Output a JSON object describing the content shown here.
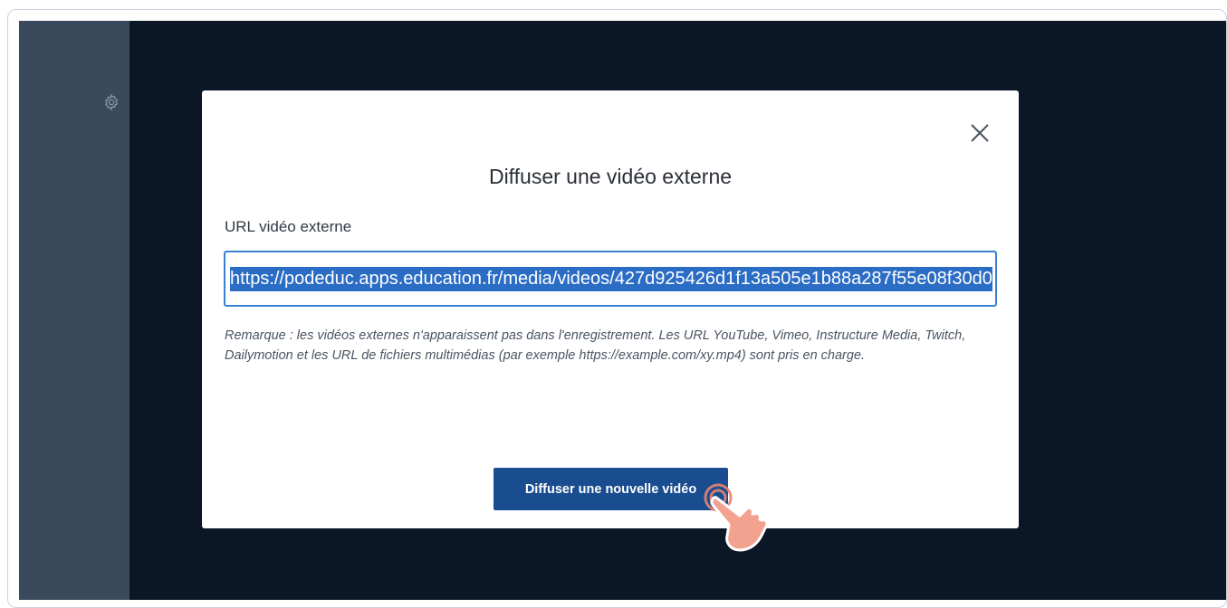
{
  "modal": {
    "title": "Diffuser une vidéo externe",
    "field_label": "URL vidéo externe",
    "url_value": "https://podeduc.apps.education.fr/media/videos/427d925426d1f13a505e1b88a287f55e08f30d0",
    "remark": "Remarque : les vidéos externes n'apparaissent pas dans l'enregistrement. Les URL YouTube, Vimeo, Instructure Media, Twitch, Dailymotion et les URL de fichiers multimédias (par exemple https://example.com/xy.mp4) sont pris en charge.",
    "submit_label": "Diffuser une nouvelle vidéo",
    "close_icon": "close-icon"
  },
  "sidebar": {
    "settings_icon": "gear-icon"
  },
  "colors": {
    "backdrop": "#0b1626",
    "sidebar": "#3a4a5c",
    "primary_button": "#1a4d8f",
    "input_border": "#3b7fd1",
    "selection": "#2b6cc4"
  }
}
